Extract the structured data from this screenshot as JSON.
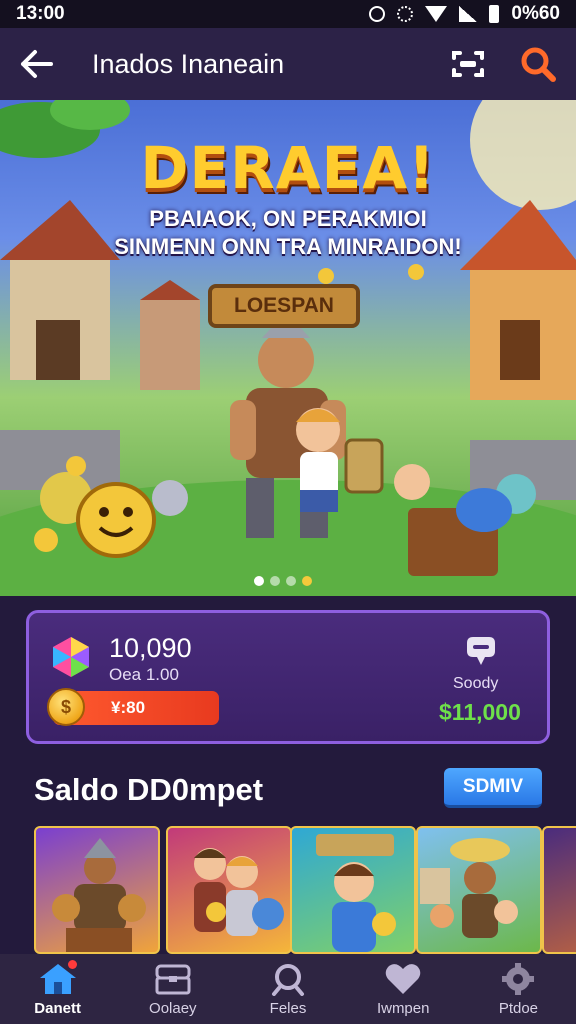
{
  "status_bar": {
    "time": "13:00",
    "right_text": "0%60",
    "icons": [
      "alarm-icon",
      "settings-icon",
      "wifi-icon",
      "signal-icon",
      "battery-icon"
    ]
  },
  "app_bar": {
    "title": "Inados Inaneain",
    "icons": [
      "back-arrow-icon",
      "scan-frame-icon",
      "search-icon"
    ],
    "accent": "#ff6a2a"
  },
  "banner": {
    "title": "DERAEA!",
    "subtitle_1": "PBAIAOK, ON PERAKMIOI",
    "subtitle_2": "SINMENN ONN TRA MINRAIDON!",
    "sign": "LOESPAN",
    "carousel_total": 4,
    "carousel_active": 1
  },
  "wallet": {
    "balance": "10,090",
    "sub": "Oea 1.00",
    "bonus": "¥:80",
    "coin_symbol": "$",
    "label": "Soody",
    "amount": "$11,000",
    "amount_color": "#6ee04a"
  },
  "section": {
    "title": "Saldo DD0mpet",
    "button": "SDMIV"
  },
  "cards": [
    {
      "name": "warrior-card"
    },
    {
      "name": "duo-heroes-card"
    },
    {
      "name": "boy-hero-card"
    },
    {
      "name": "village-card"
    }
  ],
  "bottom_nav": [
    {
      "label": "Danett",
      "icon": "home-icon",
      "active": true
    },
    {
      "label": "Oolaey",
      "icon": "chest-icon",
      "active": false
    },
    {
      "label": "Feles",
      "icon": "magnifier-icon",
      "active": false
    },
    {
      "label": "Iwmpen",
      "icon": "heart-icon",
      "active": false
    },
    {
      "label": "Ptdoe",
      "icon": "gear-icon",
      "active": false
    }
  ]
}
